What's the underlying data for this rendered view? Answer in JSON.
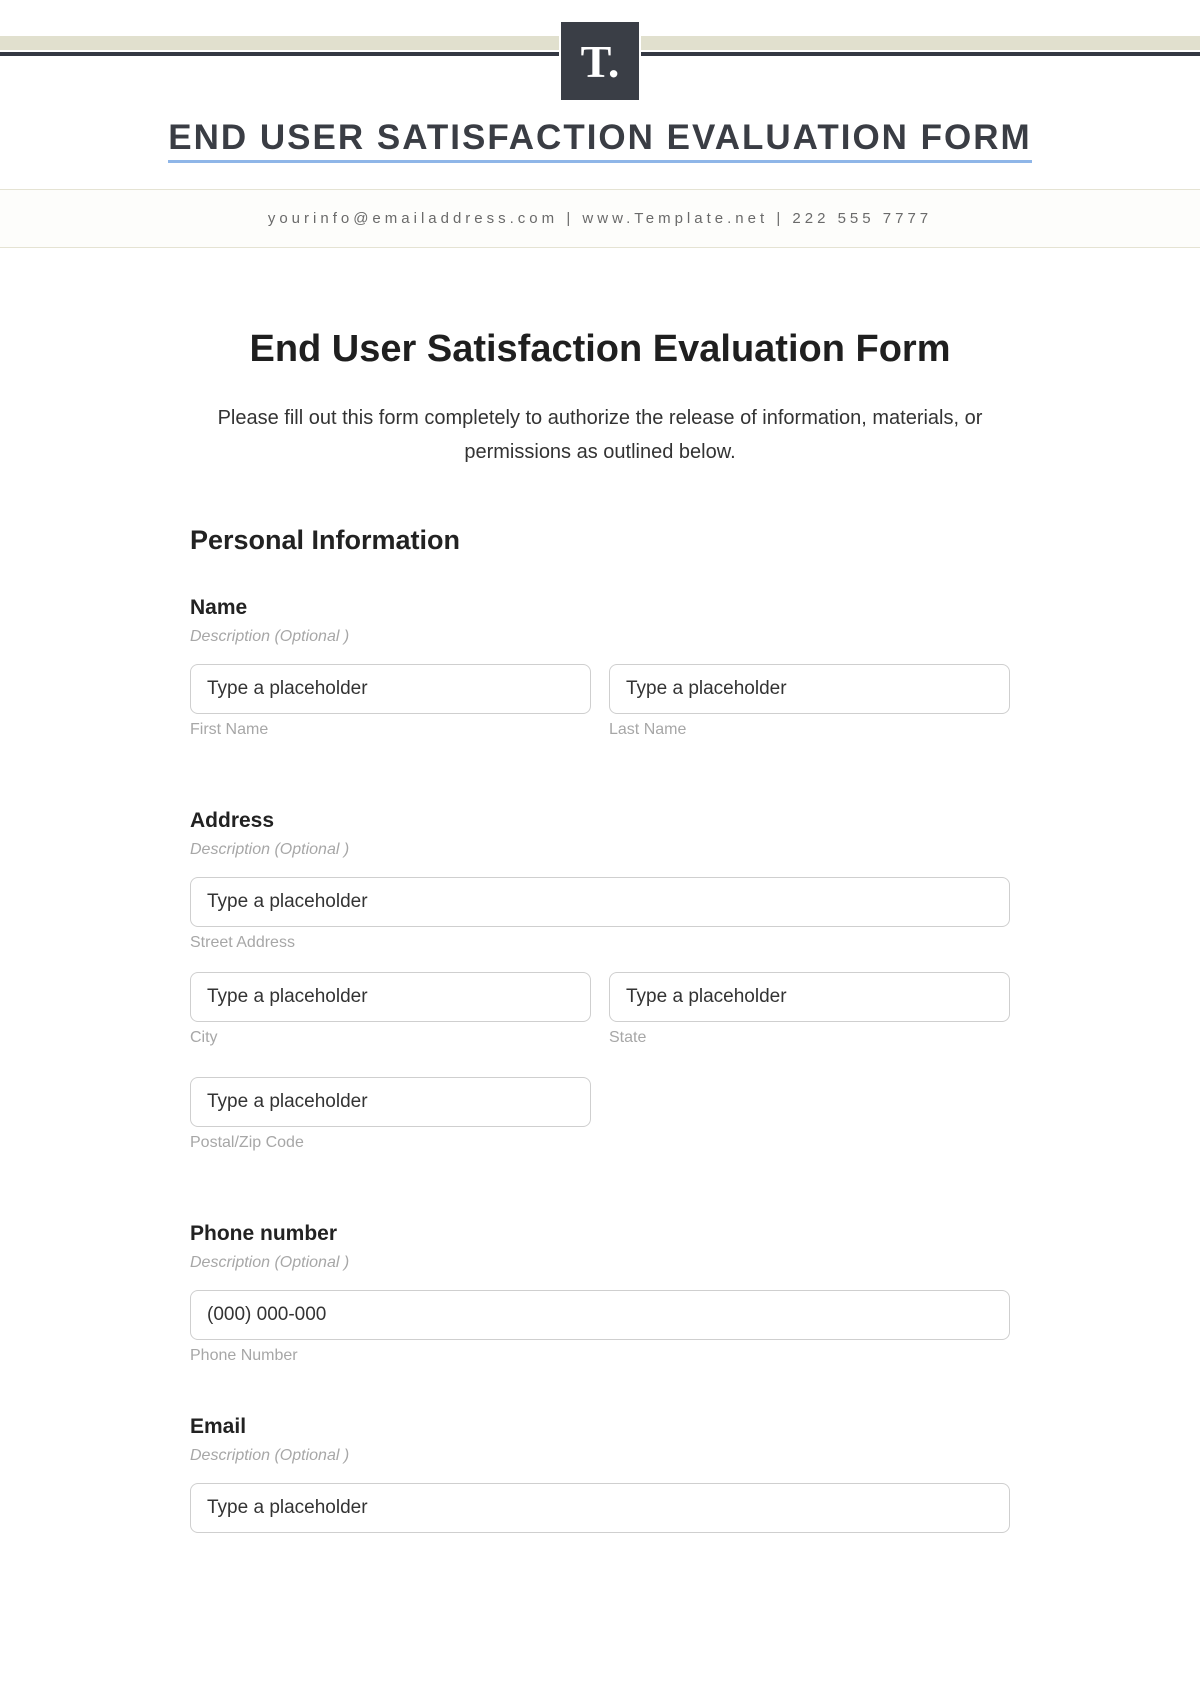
{
  "logo_text": "T.",
  "banner_title": "END USER SATISFACTION EVALUATION FORM",
  "contact": {
    "email": "yourinfo@emailaddress.com",
    "site": "www.Template.net",
    "phone": "222 555 7777"
  },
  "page_title": "End User Satisfaction Evaluation Form",
  "page_description": "Please fill out this form completely to authorize the release of information, materials, or permissions as outlined below.",
  "section_personal": "Personal Information",
  "desc_optional": "Description  (Optional )",
  "placeholder_generic": "Type a placeholder",
  "fields": {
    "name": {
      "label": "Name",
      "first_sub": "First Name",
      "last_sub": "Last Name"
    },
    "address": {
      "label": "Address",
      "street_sub": "Street Address",
      "city_sub": "City",
      "state_sub": "State",
      "postal_sub": "Postal/Zip Code"
    },
    "phone": {
      "label": "Phone number",
      "placeholder": "(000) 000-000",
      "sub": "Phone Number"
    },
    "email": {
      "label": "Email"
    }
  }
}
